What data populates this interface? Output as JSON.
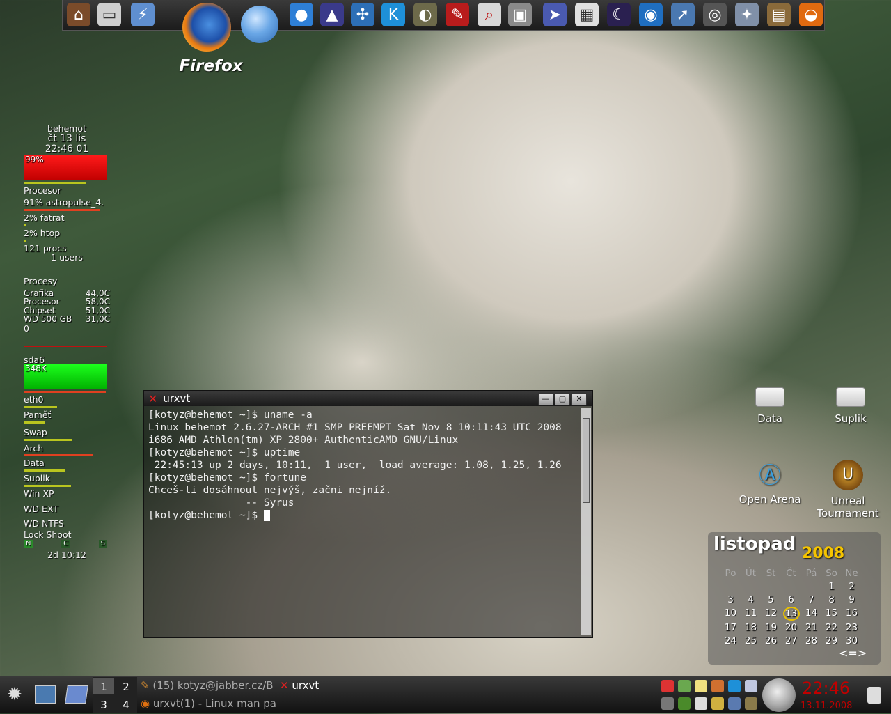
{
  "launcher": {
    "icons": [
      "home-icon",
      "drive-icon",
      "usb-icon",
      "firefox-icon",
      "network-globe-icon",
      "kde-earth-icon",
      "rocket-icon",
      "network-icon",
      "kopete-icon",
      "gimp-icon",
      "pencil-icon",
      "image-viewer-icon",
      "camera-icon",
      "presentation-icon",
      "calculator-icon",
      "night-icon",
      "browser-icon",
      "ftp-icon",
      "disc-icon",
      "media-icon",
      "movie-icon",
      "vlc-icon"
    ],
    "firefox_label": "Firefox"
  },
  "conky": {
    "host": "behemot",
    "date_line": "čt 13 lis",
    "time_line": "22:46 01",
    "cpu_percent": "99%",
    "cpu_label": "Procesor",
    "top1": "91% astropulse_4.",
    "top2": "2% fatrat",
    "top3": "2% htop",
    "procs": "121 procs",
    "users": "1 users",
    "procs_label": "Procesy",
    "temps": [
      {
        "name": "Grafika",
        "value": "44,0C"
      },
      {
        "name": "Procesor",
        "value": "58,0C"
      },
      {
        "name": "Chipset",
        "value": "51,0C"
      },
      {
        "name": "WD 500 GB",
        "value": "31,0C"
      }
    ],
    "zero": "0",
    "disk": "sda6",
    "disk_rate": "348K",
    "net": "eth0",
    "mem": "Paměť",
    "swap": "Swap",
    "mounts": [
      "Arch",
      "Data",
      "Suplik",
      "Win XP",
      "WD EXT",
      "WD NTFS"
    ],
    "locks": "Lock  Shoot",
    "lock_keys": [
      "N",
      "C",
      "S"
    ],
    "uptime": "2d 10:12"
  },
  "terminal": {
    "title": "urxvt",
    "lines": [
      "[kotyz@behemot ~]$ uname -a",
      "Linux behemot 2.6.27-ARCH #1 SMP PREEMPT Sat Nov 8 10:11:43 UTC 2008",
      "i686 AMD Athlon(tm) XP 2800+ AuthenticAMD GNU/Linux",
      "[kotyz@behemot ~]$ uptime",
      " 22:45:13 up 2 days, 10:11,  1 user,  load average: 1.08, 1.25, 1.26",
      "[kotyz@behemot ~]$ fortune",
      "Chceš-li dosáhnout nejvýš, začni nejníž.",
      "                -- Syrus",
      "[kotyz@behemot ~]$ "
    ]
  },
  "desktop_icons": {
    "data": "Data",
    "suplik": "Suplik",
    "open_arena": "Open Arena",
    "unreal": "Unreal Tournament"
  },
  "calendar": {
    "month": "listopad",
    "year": "2008",
    "weekdays": [
      "Po",
      "Út",
      "St",
      "Čt",
      "Pá",
      "So",
      "Ne"
    ],
    "days": [
      "",
      "",
      "",
      "",
      "",
      "1",
      "2",
      "3",
      "4",
      "5",
      "6",
      "7",
      "8",
      "9",
      "10",
      "11",
      "12",
      "13",
      "14",
      "15",
      "16",
      "17",
      "18",
      "19",
      "20",
      "21",
      "22",
      "23",
      "24",
      "25",
      "26",
      "27",
      "28",
      "29",
      "30"
    ],
    "today": "13",
    "nav": "<=>"
  },
  "taskbar": {
    "desktops": [
      "1",
      "2",
      "3",
      "4"
    ],
    "task1": "(15) kotyz@jabber.cz/B",
    "task2": "urxvt",
    "task3": "urxvt(1) - Linux man pa",
    "clock": "22:46",
    "date": "13.11.2008"
  }
}
